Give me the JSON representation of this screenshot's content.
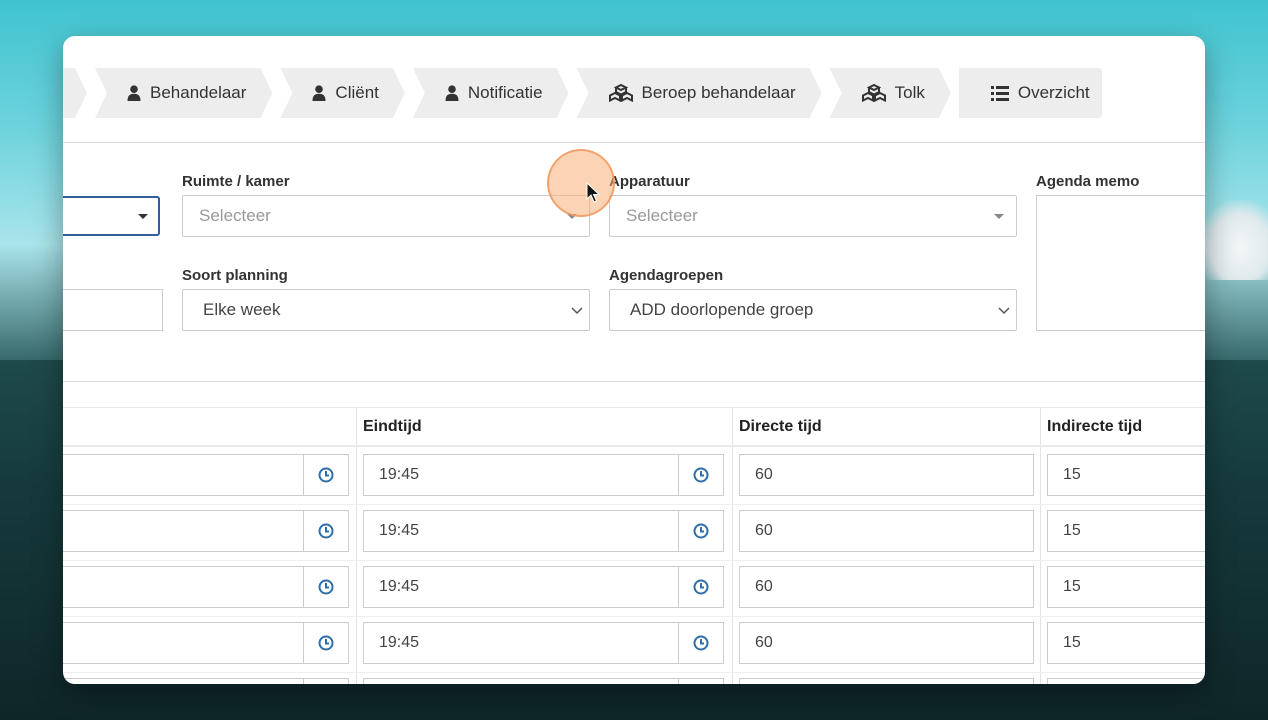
{
  "wizard": {
    "steps": [
      {
        "label": "",
        "icon": "chevron-icon"
      },
      {
        "label": "Behandelaar",
        "icon": "user-icon"
      },
      {
        "label": "Cliënt",
        "icon": "user-icon"
      },
      {
        "label": "Notificatie",
        "icon": "user-icon"
      },
      {
        "label": "Beroep behandelaar",
        "icon": "cubes-icon"
      },
      {
        "label": "Tolk",
        "icon": "cubes-icon"
      },
      {
        "label": "Overzicht",
        "icon": "list-icon"
      }
    ]
  },
  "form": {
    "room": {
      "label": "Ruimte / kamer",
      "placeholder": "Selecteer"
    },
    "equipment": {
      "label": "Apparatuur",
      "placeholder": "Selecteer"
    },
    "memo": {
      "label": "Agenda memo",
      "value": ""
    },
    "planning": {
      "label": "Soort planning",
      "value": "Elke week"
    },
    "groups": {
      "label": "Agendagroepen",
      "value": "ADD doorlopende groep"
    }
  },
  "table": {
    "headers": {
      "end": "Eindtijd",
      "direct": "Directe tijd",
      "indirect": "Indirecte tijd"
    },
    "rows": [
      {
        "end": "19:45",
        "direct": "60",
        "indirect": "15"
      },
      {
        "end": "19:45",
        "direct": "60",
        "indirect": "15"
      },
      {
        "end": "19:45",
        "direct": "60",
        "indirect": "15"
      },
      {
        "end": "19:45",
        "direct": "60",
        "indirect": "15"
      }
    ]
  },
  "colors": {
    "accent": "#2f6fa8",
    "focus": "#2f5f9a",
    "step_bg": "#ededed",
    "cursor_halo": "#f5b078"
  }
}
